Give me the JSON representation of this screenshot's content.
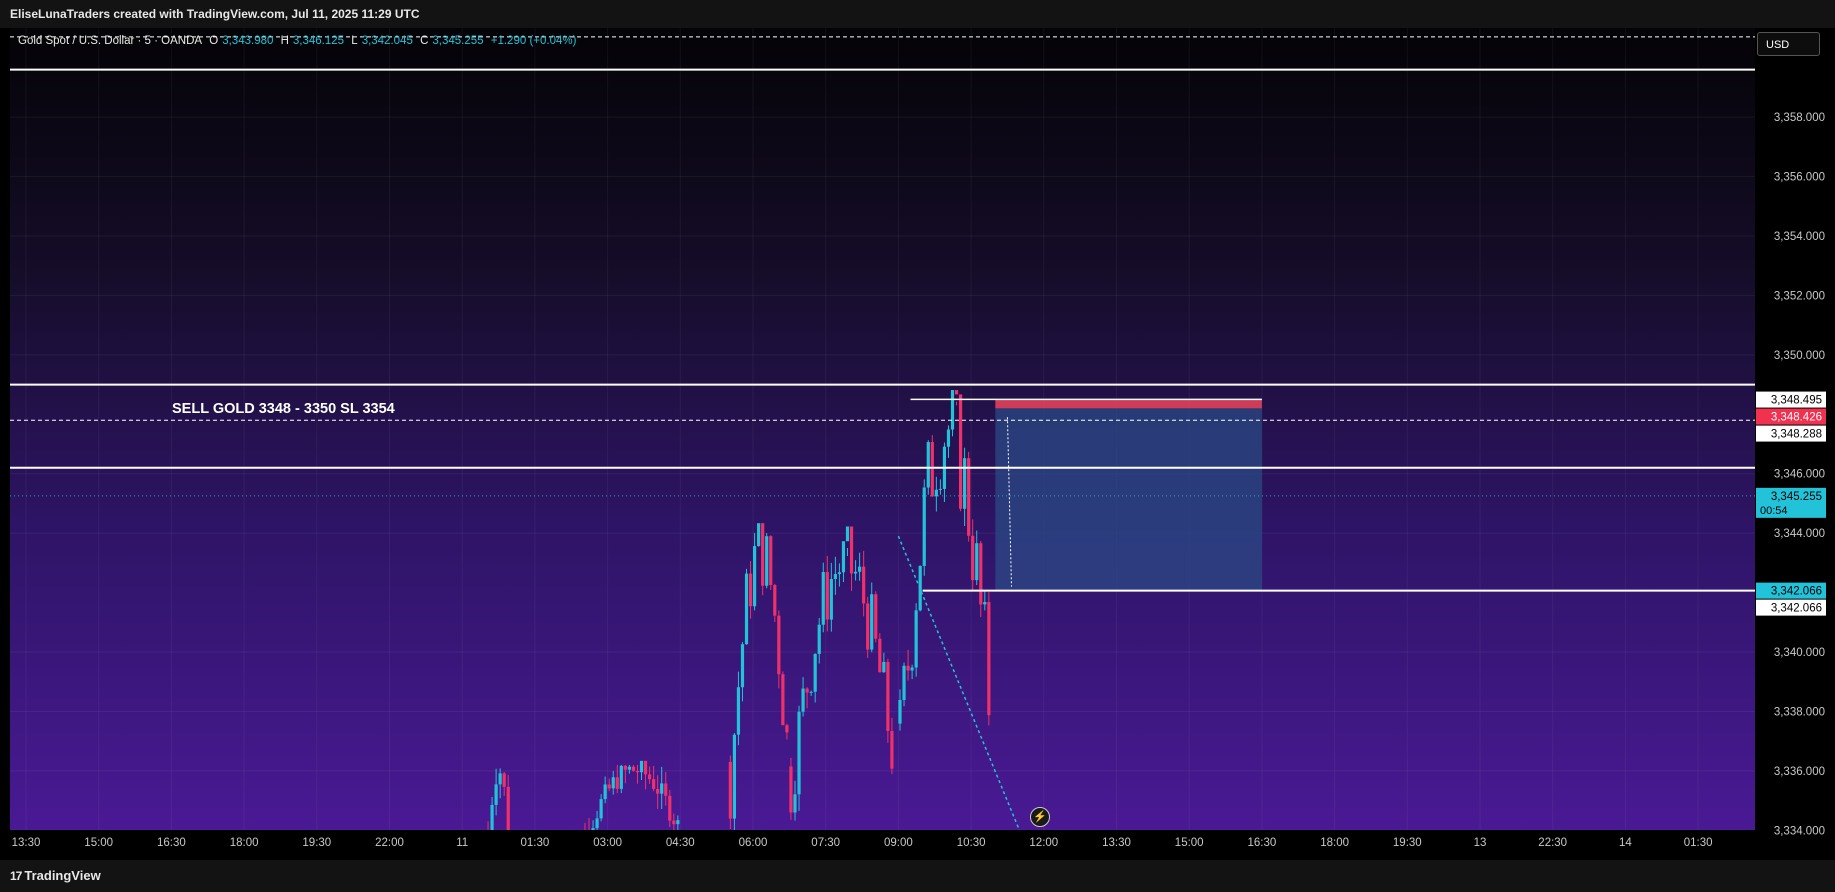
{
  "header": {
    "title": "EliseLunaTraders created with TradingView.com, Jul 11, 2025 11:29 UTC"
  },
  "legend": {
    "symbol": "Gold Spot / U.S. Dollar · 5 · OANDA",
    "o_label": "O",
    "o": "3,343.980",
    "h_label": "H",
    "h": "3,346.125",
    "l_label": "L",
    "l": "3,342.045",
    "c_label": "C",
    "c": "3,345.255",
    "change": "+1.290 (+0.04%)"
  },
  "currency_button": "USD",
  "annotation": "SELL GOLD 3348 - 3350 SL 3354",
  "footer": {
    "brand": "TradingView"
  },
  "colors": {
    "up": "#22c3d9",
    "down": "#f0306a",
    "bg_top": "#040306",
    "bg_bottom": "#4c1a99",
    "tp_zone": "#2b4a86",
    "sl_zone": "#e0435a"
  },
  "icons": {
    "alert": "lightning-bolt-icon",
    "logo": "tradingview-logo-icon"
  },
  "chart_data": {
    "type": "candlestick",
    "ylim": [
      3333.0,
      3361.0
    ],
    "y_ticks": [
      "3,358.000",
      "3,356.000",
      "3,354.000",
      "3,352.000",
      "3,350.000",
      "3,346.000",
      "3,344.000",
      "3,340.000",
      "3,338.000",
      "3,336.000",
      "3,334.000"
    ],
    "x_ticks": [
      "13:30",
      "15:00",
      "16:30",
      "18:00",
      "19:30",
      "22:00",
      "11",
      "01:30",
      "03:00",
      "04:30",
      "06:00",
      "07:30",
      "09:00",
      "10:30",
      "12:00",
      "13:30",
      "15:00",
      "16:30",
      "18:00",
      "19:30",
      "13",
      "22:30",
      "14",
      "01:30"
    ],
    "horizontal_lines": [
      3359.6,
      3349.0,
      3346.2,
      3342.066
    ],
    "dashed_lines": [
      3360.7,
      3347.8
    ],
    "price_labels": [
      {
        "text": "3,348.495",
        "value": 3348.495,
        "style": "white"
      },
      {
        "text": "3,348.426",
        "value": 3348.426,
        "style": "red"
      },
      {
        "text": "3,348.288",
        "value": 3348.288,
        "style": "white"
      },
      {
        "text": "3,345.255",
        "value": 3345.255,
        "style": "cyan",
        "sub": "00:54"
      },
      {
        "text": "3,342.066",
        "value": 3342.066,
        "style": "cyan"
      },
      {
        "text": "3,342.066",
        "value": 3342.066,
        "style": "white"
      }
    ],
    "position": {
      "entry": 3348.2,
      "stop": 3348.5,
      "target": 3342.066
    },
    "approx_candle_segments": [
      {
        "from_time": "00:30",
        "to_time": "01:00",
        "lo": 3333.0,
        "hi": 3336.2
      },
      {
        "from_time": "02:30",
        "to_time": "04:30",
        "lo": 3333.0,
        "hi": 3336.2
      },
      {
        "from_time": "05:30",
        "to_time": "06:45",
        "lo": 3333.0,
        "hi": 3344.0
      },
      {
        "from_time": "06:45",
        "to_time": "09:00",
        "lo": 3333.0,
        "hi": 3343.5
      },
      {
        "from_time": "09:00",
        "to_time": "11:00",
        "lo": 3333.0,
        "hi": 3348.3
      }
    ],
    "last_close": 3345.255
  }
}
